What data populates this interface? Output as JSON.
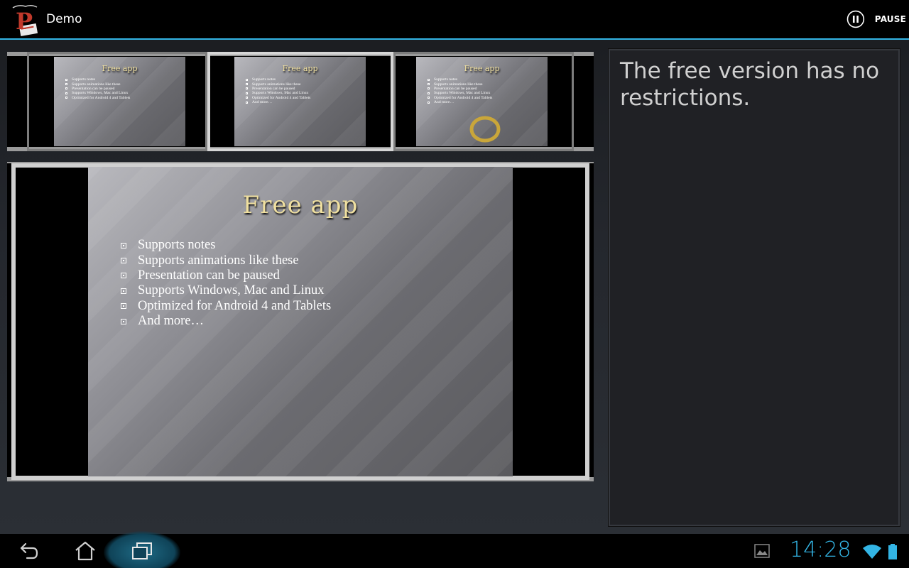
{
  "actionbar": {
    "title": "Demo",
    "app_icon": "presentation-app-icon",
    "pause_label": "PAUSE",
    "pause_icon": "pause-icon",
    "accent_color": "#33b5e5"
  },
  "slide": {
    "title": "Free app",
    "title_color": "#f0e0a0",
    "bullets": [
      "Supports notes",
      "Supports animations like these",
      "Presentation can be paused",
      "Supports Windows, Mac and Linux",
      "Optimized for Android 4 and Tablets",
      "And more…"
    ]
  },
  "filmstrip": {
    "thumbnails": [
      {
        "title": "Free app",
        "selected": false,
        "animation_ring": false
      },
      {
        "title": "Free app",
        "selected": true,
        "animation_ring": false
      },
      {
        "title": "Free app",
        "selected": false,
        "animation_ring": true
      }
    ]
  },
  "notes": {
    "text": "The free version has no restrictions."
  },
  "navbar": {
    "back_icon": "back-icon",
    "home_icon": "home-icon",
    "recents_icon": "recent-apps-icon",
    "gallery_icon": "gallery-notification-icon",
    "clock": "14:28",
    "wifi_icon": "wifi-icon",
    "battery_icon": "battery-icon"
  }
}
